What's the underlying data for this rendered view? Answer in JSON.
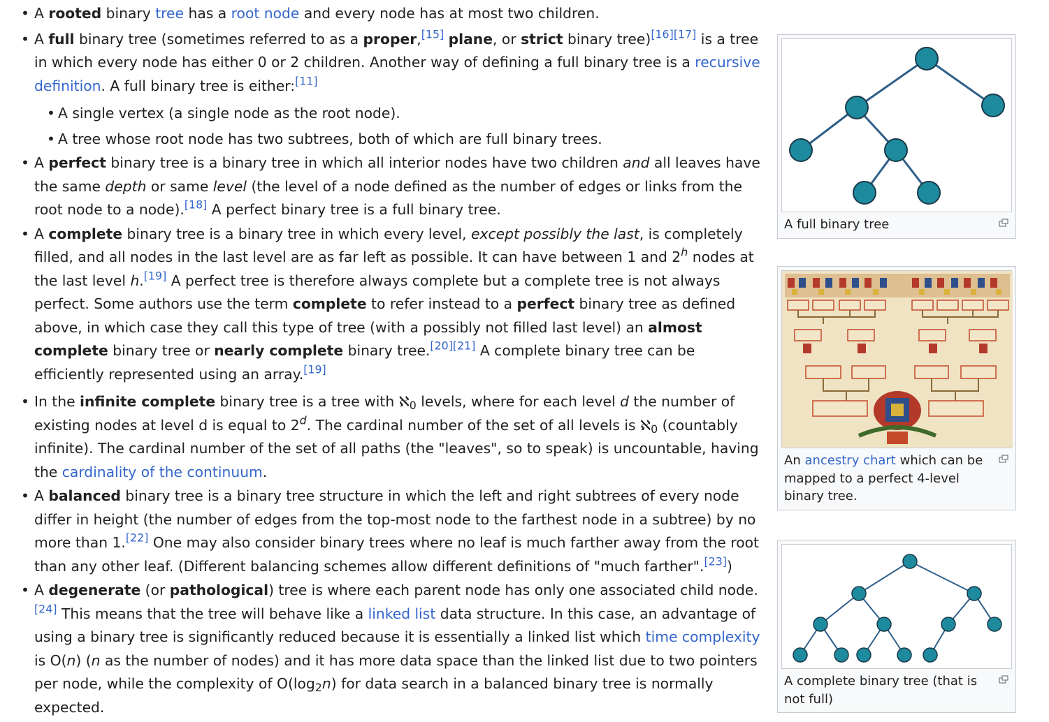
{
  "items": {
    "rooted": {
      "t1": "A ",
      "b1": "rooted",
      "t2": " binary ",
      "l1": "tree",
      "t3": " has a ",
      "l2": "root node",
      "t4": " and every node has at most two children."
    },
    "full": {
      "t1": "A ",
      "b1": "full",
      "t2": " binary tree (sometimes referred to as a ",
      "b2": "proper",
      "t3": ",",
      "r1": "[15]",
      "t4": " ",
      "b3": "plane",
      "t5": ", or ",
      "b4": "strict",
      "t6": " binary tree)",
      "r2": "[16]",
      "r3": "[17]",
      "t7": " is a tree in which every node has either 0 or 2 children. Another way of defining a full binary tree is a ",
      "l1": "recursive definition",
      "t8": ". A full binary tree is either:",
      "r4": "[11]",
      "sub1": "A single vertex (a single node as the root node).",
      "sub2": "A tree whose root node has two subtrees, both of which are full binary trees."
    },
    "perfect": {
      "t1": "A ",
      "b1": "perfect",
      "t2": " binary tree is a binary tree in which all interior nodes have two children ",
      "i1": "and",
      "t3": " all leaves have the same ",
      "i2": "depth",
      "t4": " or same ",
      "i3": "level",
      "t5": " (the level of a node defined as the number of edges or links from the root node to a node).",
      "r1": "[18]",
      "t6": " A perfect binary tree is a full binary tree."
    },
    "complete": {
      "t1": "A ",
      "b1": "complete",
      "t2": " binary tree is a binary tree in which every level, ",
      "i1": "except possibly the last",
      "t3": ", is completely filled, and all nodes in the last level are as far left as possible. It can have between 1 and 2",
      "s1": "h",
      "t4": " nodes at the last level ",
      "i2": "h",
      "t5": ".",
      "r1": "[19]",
      "t6": " A perfect tree is therefore always complete but a complete tree is not always perfect. Some authors use the term ",
      "b2": "complete",
      "t7": " to refer instead to a ",
      "b3": "perfect",
      "t8": " binary tree as defined above, in which case they call this type of tree (with a possibly not filled last level) an ",
      "b4": "almost complete",
      "t9": " binary tree or ",
      "b5": "nearly complete",
      "t10": " binary tree.",
      "r2": "[20]",
      "r3": "[21]",
      "t11": " A complete binary tree can be efficiently represented using an array.",
      "r4": "[19]"
    },
    "infinite": {
      "t1": "In the ",
      "b1": "infinite complete",
      "t2": " binary tree is a tree with ",
      "m1": "ℵ",
      "m1s": "0",
      "t3": " levels, where for each level ",
      "i1": "d",
      "t4": " the number of existing nodes at level d is equal to 2",
      "s1": "d",
      "t5": ". The cardinal number of the set of all levels is ",
      "m2": "ℵ",
      "m2s": "0",
      "t6": " (countably infinite). The cardinal number of the set of all paths (the \"leaves\", so to speak) is uncountable, having the ",
      "l1": "cardinality of the continuum",
      "t7": "."
    },
    "balanced": {
      "t1": "A ",
      "b1": "balanced",
      "t2": " binary tree is a binary tree structure in which the left and right subtrees of every node differ in height (the number of edges from the top-most node to the farthest node in a subtree) by no more than 1.",
      "r1": "[22]",
      "t3": " One may also consider binary trees where no leaf is much farther away from the root than any other leaf. (Different balancing schemes allow different definitions of \"much farther\".",
      "r2": "[23]",
      "t4": ")"
    },
    "degenerate": {
      "t1": "A ",
      "b1": "degenerate",
      "t2": " (or ",
      "b2": "pathological",
      "t3": ") tree is where each parent node has only one associated child node.",
      "r1": "[24]",
      "t4": " This means that the tree will behave like a ",
      "l1": "linked list",
      "t5": " data structure. In this case, an advantage of using a binary tree is significantly reduced because it is essentially a linked list which ",
      "l2": "time complexity",
      "t6": " is O(",
      "i1": "n",
      "t7": ") (",
      "i2": "n",
      "t8": " as the number of nodes) and it has more data space than the linked list due to two pointers per node, while the complexity of O(log",
      "s1": "2",
      "i3": "n",
      "t9": ") for data search in a balanced binary tree is normally expected."
    }
  },
  "figures": {
    "full_tree": {
      "caption": "A full binary tree"
    },
    "ancestry": {
      "c1": "An ",
      "link": "ancestry chart",
      "c2": " which can be mapped to a perfect 4-level binary tree."
    },
    "complete_tree": {
      "caption": "A complete binary tree (that is not full)"
    }
  },
  "colors": {
    "node_fill": "#1e8a9e",
    "node_stroke": "#1a3a4a",
    "edge": "#2f5f8a",
    "link": "#3366cc"
  },
  "icons": {
    "enlarge": "enlarge-icon"
  }
}
